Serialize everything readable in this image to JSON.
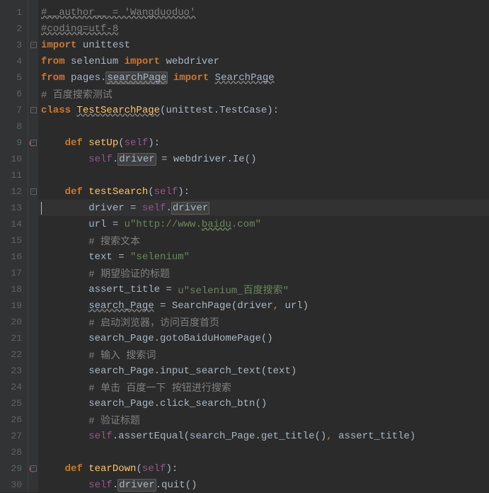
{
  "lines": [
    {
      "n": "1"
    },
    {
      "n": "2"
    },
    {
      "n": "3"
    },
    {
      "n": "4"
    },
    {
      "n": "5"
    },
    {
      "n": "6"
    },
    {
      "n": "7"
    },
    {
      "n": "8"
    },
    {
      "n": "9"
    },
    {
      "n": "10"
    },
    {
      "n": "11"
    },
    {
      "n": "12"
    },
    {
      "n": "13"
    },
    {
      "n": "14"
    },
    {
      "n": "15"
    },
    {
      "n": "16"
    },
    {
      "n": "17"
    },
    {
      "n": "18"
    },
    {
      "n": "19"
    },
    {
      "n": "20"
    },
    {
      "n": "21"
    },
    {
      "n": "22"
    },
    {
      "n": "23"
    },
    {
      "n": "24"
    },
    {
      "n": "25"
    },
    {
      "n": "26"
    },
    {
      "n": "27"
    },
    {
      "n": "28"
    },
    {
      "n": "29"
    },
    {
      "n": "30"
    }
  ],
  "c": {
    "l1a": "#__author__ = 'Wangduoduo'",
    "l2a": "#coding=utf-8",
    "l3a": "import ",
    "l3b": "unittest",
    "l4a": "from ",
    "l4b": "selenium ",
    "l4c": "import ",
    "l4d": "webdriver",
    "l5a": "from ",
    "l5b": "pages.",
    "l5c": "searchPage",
    "l5d": " import ",
    "l5e": "SearchPage",
    "l6a": "# 百度搜索测试",
    "l7a": "class ",
    "l7b": "TestSearchPage",
    "l7c": "(unittest.TestCase):",
    "l9a": "    def ",
    "l9b": "setUp",
    "l9c": "(",
    "l9d": "self",
    "l9e": "):",
    "l10a": "        ",
    "l10b": "self",
    "l10c": ".",
    "l10d": "driver",
    "l10e": " = webdriver.Ie()",
    "l12a": "    def ",
    "l12b": "testSearch",
    "l12c": "(",
    "l12d": "self",
    "l12e": "):",
    "l13a": "        driver = ",
    "l13b": "self",
    "l13c": ".",
    "l13d": "driver",
    "l14a": "        url = ",
    "l14b": "u\"http://www.",
    "l14c": "baidu",
    "l14d": ".com\"",
    "l15a": "        # 搜索文本",
    "l16a": "        text = ",
    "l16b": "\"selenium\"",
    "l17a": "        # 期望验证的标题",
    "l18a": "        assert_title = ",
    "l18b": "u\"selenium_百度搜索\"",
    "l19a": "        ",
    "l19b": "search_Page",
    "l19c": " = SearchPage(driver",
    "l19d": ",",
    "l19e": " url)",
    "l20a": "        # 启动浏览器，访问百度首页",
    "l21a": "        search_Page.gotoBaiduHomePage()",
    "l22a": "        # 输入 搜索词",
    "l23a": "        search_Page.input_search_text(text)",
    "l24a": "        # 单击 百度一下 按钮进行搜索",
    "l25a": "        search_Page.click_search_btn()",
    "l26a": "        # 验证标题",
    "l27a": "        ",
    "l27b": "self",
    "l27c": ".assertEqual(search_Page.get_title()",
    "l27d": ",",
    "l27e": " assert_title)",
    "l29a": "    def ",
    "l29b": "tearDown",
    "l29c": "(",
    "l29d": "self",
    "l29e": "):",
    "l30a": "        ",
    "l30b": "self",
    "l30c": ".",
    "l30d": "driver",
    "l30e": ".quit()"
  }
}
